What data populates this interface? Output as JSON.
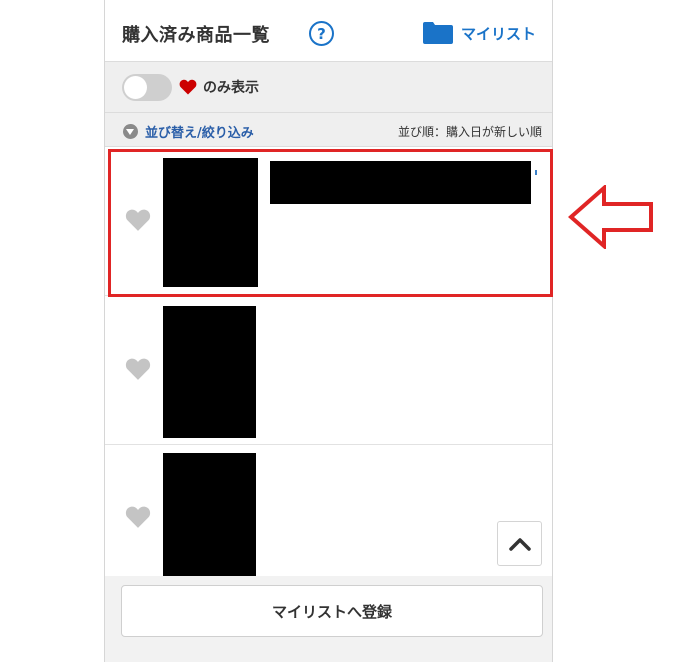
{
  "header": {
    "title": "購入済み商品一覧",
    "help_symbol": "?",
    "mylist_label": "マイリスト",
    "icons": {
      "help": "question-circle-icon",
      "mylist": "folder-icon"
    }
  },
  "filter": {
    "toggle_on": false,
    "only_label": "のみ表示",
    "heart_icon": "heart-icon",
    "heart_color": "#cc0000"
  },
  "sort": {
    "toggle_label": "並び替え/絞り込み",
    "order_text": "並び順：購入日が新しい順"
  },
  "items": [
    {
      "favorite": false
    },
    {
      "favorite": false
    },
    {
      "favorite": false
    }
  ],
  "footer": {
    "register_label": "マイリストへ登録",
    "scroll_top_icon": "chevron-up-icon"
  },
  "colors": {
    "accent": "#1a73c8",
    "highlight": "#e02525",
    "link": "#2a5ea8"
  }
}
